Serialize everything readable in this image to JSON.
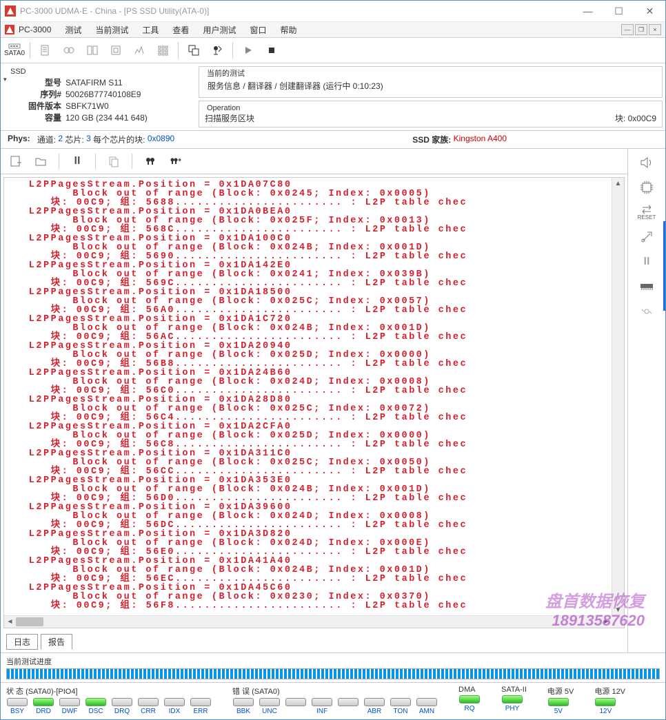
{
  "title": "PC-3000 UDMA-E - China - [PS SSD Utility(ATA-0)]",
  "mdi_title": "PC-3000",
  "menu": [
    "测试",
    "当前测试",
    "工具",
    "查看",
    "用户测试",
    "窗口",
    "帮助"
  ],
  "device_port": "SATA0",
  "ssd": {
    "fieldset": "SSD",
    "rows": {
      "model_lbl": "型号",
      "model": "SATAFIRM   S11",
      "serial_lbl": "序列#",
      "serial": "50026B77740108E9",
      "fw_lbl": "固件版本",
      "fw": "SBFK71W0",
      "cap_lbl": "容量",
      "cap": "120 GB (234 441 648)"
    }
  },
  "current_test": {
    "title": "当前的测试",
    "line": "服务信息 / 翻译器 / 创建翻译器 (运行中 0:10:23)"
  },
  "operation": {
    "title": "Operation",
    "left": "扫描服务区块",
    "right": "块: 0x00C9"
  },
  "phys": {
    "label": "Phys:",
    "ch_lbl": "通道:",
    "ch": "2",
    "chip_lbl": "芯片:",
    "chip": "3",
    "perchip_lbl": "每个芯片的块:",
    "perchip": "0x0890",
    "family_lbl": "SSD 家族:",
    "family": "Kingston A400"
  },
  "log_tabs": {
    "log": "日志",
    "report": "报告"
  },
  "progress_label": "当前测试进度",
  "status": {
    "g1_title": "状 态 (SATA0)-[PIO4]",
    "g1": [
      "BSY",
      "DRD",
      "DWF",
      "DSC",
      "DRQ",
      "CRR",
      "IDX",
      "ERR"
    ],
    "g2_title": "错 误 (SATA0)",
    "g2": [
      "BBK",
      "UNC",
      "",
      "INF",
      "",
      "ABR",
      "TON",
      "AMN"
    ],
    "g3_title": "DMA",
    "g3": [
      "RQ"
    ],
    "g4_title": "SATA-II",
    "g4": [
      "PHY"
    ],
    "g5_title": "电源 5V",
    "g5": [
      "5V"
    ],
    "g6_title": "电源 12V",
    "g6": [
      "12V"
    ]
  },
  "side_reset": "RESET",
  "watermark": {
    "l1": "盘首数据恢复",
    "l2": "18913587620"
  },
  "chart_data": null,
  "log_lines": [
    "L2PPagesStream.Position = 0x1DA07C80",
    "      Block out of range (Block: 0x0245; Index: 0x0005)",
    "   块: 00C9; 组: 5688....................... : L2P table chec",
    "L2PPagesStream.Position = 0x1DA0BEA0",
    "      Block out of range (Block: 0x025F; Index: 0x0013)",
    "   块: 00C9; 组: 568C....................... : L2P table chec",
    "L2PPagesStream.Position = 0x1DA100C0",
    "      Block out of range (Block: 0x024B; Index: 0x001D)",
    "   块: 00C9; 组: 5690....................... : L2P table chec",
    "L2PPagesStream.Position = 0x1DA142E0",
    "      Block out of range (Block: 0x0241; Index: 0x039B)",
    "   块: 00C9; 组: 569C....................... : L2P table chec",
    "L2PPagesStream.Position = 0x1DA18500",
    "      Block out of range (Block: 0x025C; Index: 0x0057)",
    "   块: 00C9; 组: 56A0....................... : L2P table chec",
    "L2PPagesStream.Position = 0x1DA1C720",
    "      Block out of range (Block: 0x024B; Index: 0x001D)",
    "   块: 00C9; 组: 56AC....................... : L2P table chec",
    "L2PPagesStream.Position = 0x1DA20940",
    "      Block out of range (Block: 0x025D; Index: 0x0000)",
    "   块: 00C9; 组: 56B8....................... : L2P table chec",
    "L2PPagesStream.Position = 0x1DA24B60",
    "      Block out of range (Block: 0x024D; Index: 0x0008)",
    "   块: 00C9; 组: 56C0....................... : L2P table chec",
    "L2PPagesStream.Position = 0x1DA28D80",
    "      Block out of range (Block: 0x025C; Index: 0x0072)",
    "   块: 00C9; 组: 56C4....................... : L2P table chec",
    "L2PPagesStream.Position = 0x1DA2CFA0",
    "      Block out of range (Block: 0x025D; Index: 0x0000)",
    "   块: 00C9; 组: 56C8....................... : L2P table chec",
    "L2PPagesStream.Position = 0x1DA311C0",
    "      Block out of range (Block: 0x025C; Index: 0x0050)",
    "   块: 00C9; 组: 56CC....................... : L2P table chec",
    "L2PPagesStream.Position = 0x1DA353E0",
    "      Block out of range (Block: 0x024B; Index: 0x001D)",
    "   块: 00C9; 组: 56D0....................... : L2P table chec",
    "L2PPagesStream.Position = 0x1DA39600",
    "      Block out of range (Block: 0x024D; Index: 0x0008)",
    "   块: 00C9; 组: 56DC....................... : L2P table chec",
    "L2PPagesStream.Position = 0x1DA3D820",
    "      Block out of range (Block: 0x024D; Index: 0x000E)",
    "   块: 00C9; 组: 56E0....................... : L2P table chec",
    "L2PPagesStream.Position = 0x1DA41A40",
    "      Block out of range (Block: 0x024B; Index: 0x001D)",
    "   块: 00C9; 组: 56EC....................... : L2P table chec",
    "L2PPagesStream.Position = 0x1DA45C60",
    "      Block out of range (Block: 0x0230; Index: 0x0370)",
    "   块: 00C9; 组: 56F8....................... : L2P table chec"
  ]
}
